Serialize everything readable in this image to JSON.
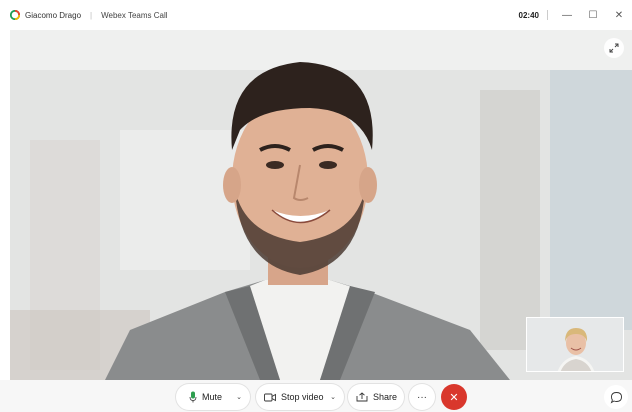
{
  "window": {
    "participant_name": "Giacomo Drago",
    "app_title": "Webex Teams Call",
    "call_timer": "02:40",
    "minimize_glyph": "—",
    "maximize_glyph": "☐",
    "close_glyph": "✕"
  },
  "icons": {
    "app_logo": "webex-logo-icon",
    "fullscreen": "expand-icon",
    "mute": "microphone-icon",
    "video": "camera-icon",
    "share": "share-screen-icon",
    "more": "more-icon",
    "end_call": "close-icon",
    "chat": "chat-bubble-icon"
  },
  "controls": {
    "mute_label": "Mute",
    "video_label": "Stop video",
    "share_label": "Share",
    "more_glyph": "···",
    "end_glyph": "✕",
    "caret_glyph": "⌄"
  },
  "colors": {
    "end_call": "#d9372c",
    "mic_active": "#2e9e4f"
  }
}
